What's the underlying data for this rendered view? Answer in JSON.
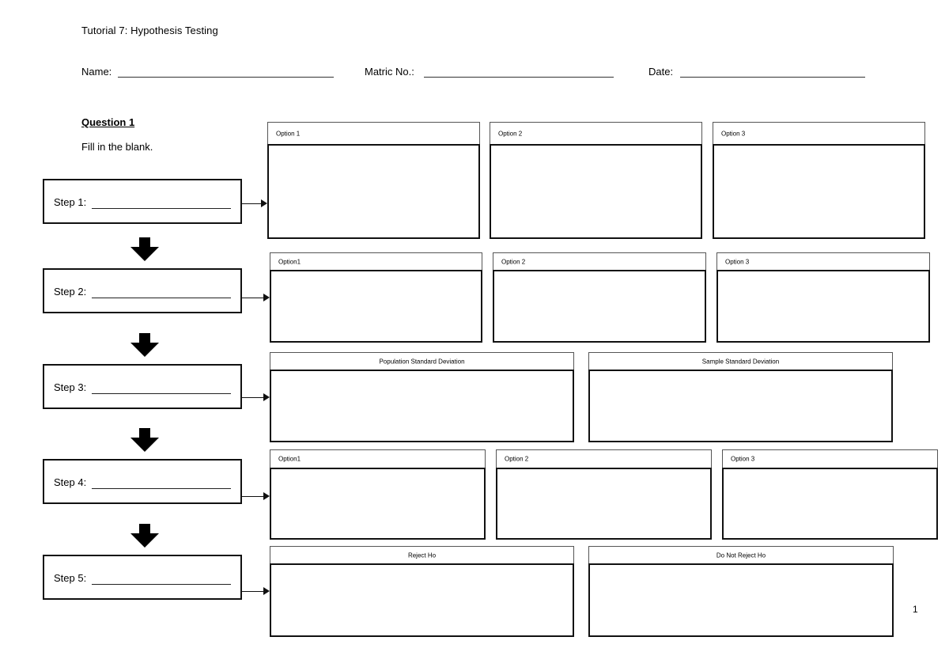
{
  "document": {
    "title": "Tutorial 7: Hypothesis Testing",
    "fields": {
      "name_label": "Name:",
      "name_value": "",
      "matric_label": "Matric No.:",
      "matric_value": "",
      "date_label": "Date:",
      "date_value": ""
    },
    "question": {
      "heading": "Question 1",
      "instruction": "Fill in the blank."
    },
    "steps": [
      {
        "label": "Step 1:",
        "value": "",
        "options": [
          "Option 1",
          "Option 2",
          "Option 3"
        ]
      },
      {
        "label": "Step 2:",
        "value": "",
        "options": [
          "Option1",
          "Option 2",
          "Option 3"
        ]
      },
      {
        "label": "Step 3:",
        "value": "",
        "options": [
          "Population Standard Deviation",
          "Sample Standard Deviation"
        ]
      },
      {
        "label": "Step 4:",
        "value": "",
        "options": [
          "Option1",
          "Option 2",
          "Option 3"
        ]
      },
      {
        "label": "Step 5:",
        "value": "",
        "options": [
          "Reject Ho",
          "Do Not Reject Ho"
        ]
      }
    ],
    "page_number": "1"
  }
}
